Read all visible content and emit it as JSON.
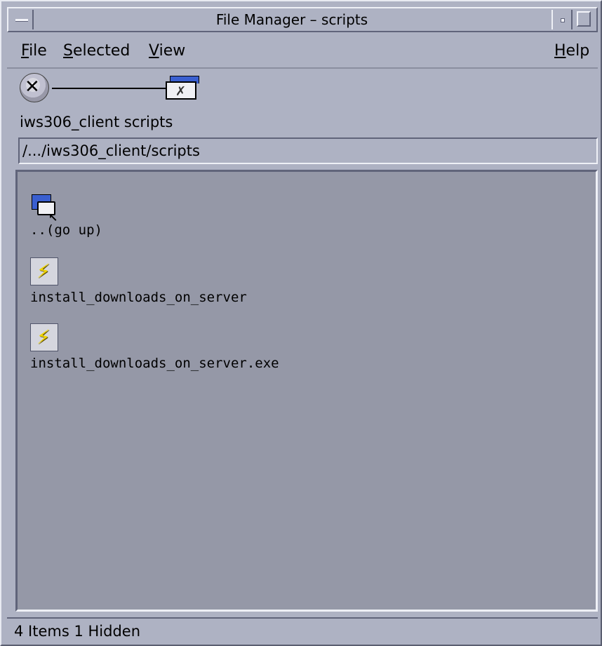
{
  "window": {
    "title": "File Manager – scripts"
  },
  "menubar": {
    "file": {
      "mnemonic": "F",
      "rest": "ile"
    },
    "selected": {
      "mnemonic": "S",
      "rest": "elected"
    },
    "view": {
      "mnemonic": "V",
      "rest": "iew"
    },
    "help": {
      "mnemonic": "H",
      "rest": "elp"
    }
  },
  "path": {
    "icons": [
      "cd-icon",
      "folder-tool-icon"
    ],
    "label": "iws306_client scripts",
    "field_value": "/.../iws306_client/scripts"
  },
  "files": [
    {
      "name": "..(go up)",
      "icon": "folder-up-icon"
    },
    {
      "name": "install_downloads_on_server",
      "icon": "executable-icon"
    },
    {
      "name": "install_downloads_on_server.exe",
      "icon": "executable-icon"
    }
  ],
  "status": {
    "text": "4 Items 1 Hidden"
  },
  "colors": {
    "window_bg": "#aeb2c3",
    "panel_bg": "#9598a7",
    "folder_blue": "#3a5fd0",
    "bolt_yellow": "#f0d400"
  }
}
